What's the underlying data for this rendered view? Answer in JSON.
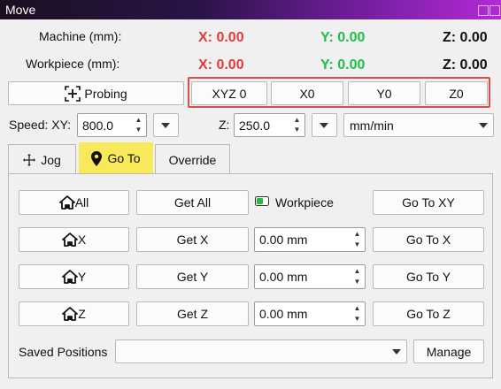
{
  "window": {
    "title": "Move"
  },
  "positions": {
    "machine_label": "Machine (mm):",
    "workpiece_label": "Workpiece (mm):",
    "machine": {
      "x": "X: 0.00",
      "y": "Y: 0.00",
      "z": "Z: 0.00"
    },
    "workpiece": {
      "x": "X: 0.00",
      "y": "Y: 0.00",
      "z": "Z: 0.00"
    },
    "colors": {
      "x": "#e23b3b",
      "y": "#1fbf4a",
      "z": "#111111"
    }
  },
  "zero_bar": {
    "probing": "Probing",
    "xyz0": "XYZ 0",
    "x0": "X0",
    "y0": "Y0",
    "z0": "Z0"
  },
  "speed": {
    "xy_label": "Speed: XY:",
    "xy_value": "800.0",
    "z_label": "Z:",
    "z_value": "250.0",
    "units": "mm/min"
  },
  "tabs": [
    {
      "label": "Jog",
      "icon": "move-arrows-icon"
    },
    {
      "label": "Go To",
      "icon": "location-pin-icon",
      "active": true
    },
    {
      "label": "Override"
    }
  ],
  "goto": {
    "home_all": "All",
    "home_x": "X",
    "home_y": "Y",
    "home_z": "Z",
    "get_all": "Get All",
    "get_x": "Get X",
    "get_y": "Get Y",
    "get_z": "Get Z",
    "workpiece_toggle": "Workpiece",
    "x_value": "0.00 mm",
    "y_value": "0.00 mm",
    "z_value": "0.00 mm",
    "go_xy": "Go To XY",
    "go_x": "Go To X",
    "go_y": "Go To Y",
    "go_z": "Go To Z",
    "saved_label": "Saved Positions",
    "saved_value": "",
    "manage": "Manage"
  }
}
